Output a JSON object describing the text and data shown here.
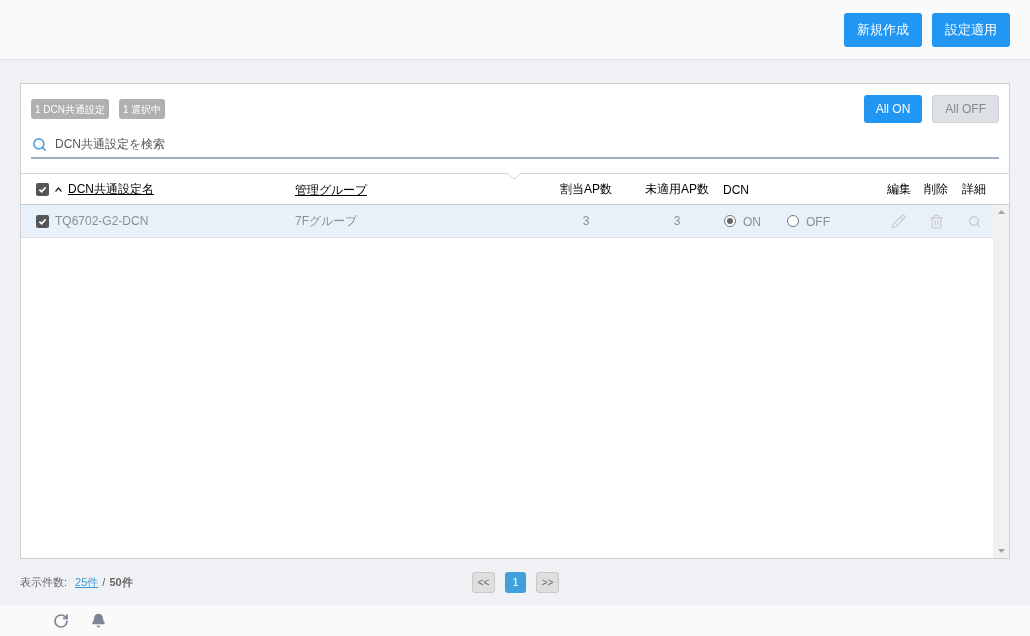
{
  "top_buttons": [
    "新規作成",
    "設定適用"
  ],
  "badges": [
    "1 DCN共通設定",
    "1 選択中"
  ],
  "toggle_buttons": [
    {
      "label": "All ON",
      "selected": true
    },
    {
      "label": "All OFF",
      "selected": false
    }
  ],
  "search": {
    "placeholder": "DCN共通設定を検索"
  },
  "table": {
    "select_all_checked": true,
    "columns": [
      {
        "label": "DCN共通設定名",
        "sortable": true,
        "sorted": true
      },
      {
        "label": "管理グループ",
        "sortable": true,
        "sorted": false
      },
      {
        "label": "割当AP数",
        "sortable": false,
        "sorted": false
      },
      {
        "label": "未適用AP数",
        "sortable": false,
        "sorted": false
      },
      {
        "label": "DCN",
        "sortable": false,
        "sorted": false
      },
      {
        "label": "編集",
        "sortable": false,
        "sorted": false
      },
      {
        "label": "削除",
        "sortable": false,
        "sorted": false
      },
      {
        "label": "詳細",
        "sortable": false,
        "sorted": false
      }
    ],
    "rows": [
      {
        "checked": true,
        "selected": true,
        "name": "TQ6702-G2-DCN",
        "group": "7Fグループ",
        "assigned_ap": "3",
        "unapplied_ap": "3",
        "dcn_options": [
          {
            "label": "ON",
            "selected": true
          },
          {
            "label": "OFF",
            "selected": false
          }
        ]
      }
    ]
  },
  "footer": {
    "label": "表示件数:",
    "per_page": "25件",
    "separator": "/",
    "total": "50件"
  },
  "pagination": {
    "prev": "<<",
    "pages": [
      {
        "label": "1",
        "selected": true
      }
    ],
    "next": ">>"
  }
}
